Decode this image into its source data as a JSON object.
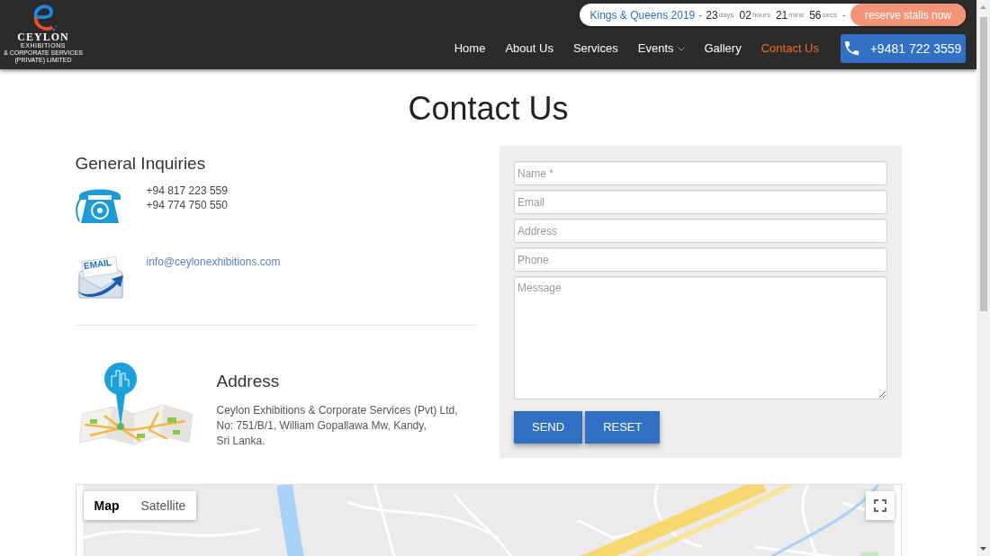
{
  "header": {
    "logo": {
      "wordmark": "CEYLON",
      "line_2": "EXHIBITIONS",
      "line_3": "& CORPORATE SERVICES",
      "line_4": "(PRIVATE) LIMITED"
    },
    "countdown": {
      "event": "Kings & Queens 2019",
      "separator": "-",
      "units": [
        {
          "value": "23",
          "unit": "days"
        },
        {
          "value": "02",
          "unit": "hours"
        },
        {
          "value": "21",
          "unit": "mins"
        },
        {
          "value": "56",
          "unit": "secs"
        }
      ],
      "trailing_separator": "-",
      "button": "reserve stalls now"
    },
    "nav": [
      {
        "label": "Home",
        "selected": false,
        "dropdown": false
      },
      {
        "label": "About Us",
        "selected": false,
        "dropdown": false
      },
      {
        "label": "Services",
        "selected": false,
        "dropdown": false
      },
      {
        "label": "Events",
        "selected": false,
        "dropdown": true
      },
      {
        "label": "Gallery",
        "selected": false,
        "dropdown": false
      },
      {
        "label": "Contact Us",
        "selected": true,
        "dropdown": false
      }
    ],
    "phone_button": "+9481 722 3559"
  },
  "page_title": "Contact Us",
  "general_inquiries": {
    "heading": "General Inquiries",
    "phones": [
      "+94 817 223 559",
      "+94 774 750 550"
    ],
    "email_icon_label": "EMAIL",
    "email": "info@ceylonexhibitions.com"
  },
  "address": {
    "heading": "Address",
    "lines": [
      "Ceylon Exhibitions & Corporate Services (Pvt) Ltd,",
      "No: 751/B/1, William Gopallawa Mw, Kandy,",
      "Sri Lanka."
    ]
  },
  "contact_form": {
    "fields": [
      {
        "kind": "input",
        "placeholder": "Name *"
      },
      {
        "kind": "input",
        "placeholder": "Email"
      },
      {
        "kind": "input",
        "placeholder": "Address"
      },
      {
        "kind": "input",
        "placeholder": "Phone"
      },
      {
        "kind": "textarea",
        "placeholder": "Message"
      }
    ],
    "buttons": [
      "SEND",
      "RESET"
    ]
  },
  "map": {
    "view_tabs": [
      {
        "label": "Map",
        "selected": true
      },
      {
        "label": "Satellite",
        "selected": false
      }
    ]
  }
}
